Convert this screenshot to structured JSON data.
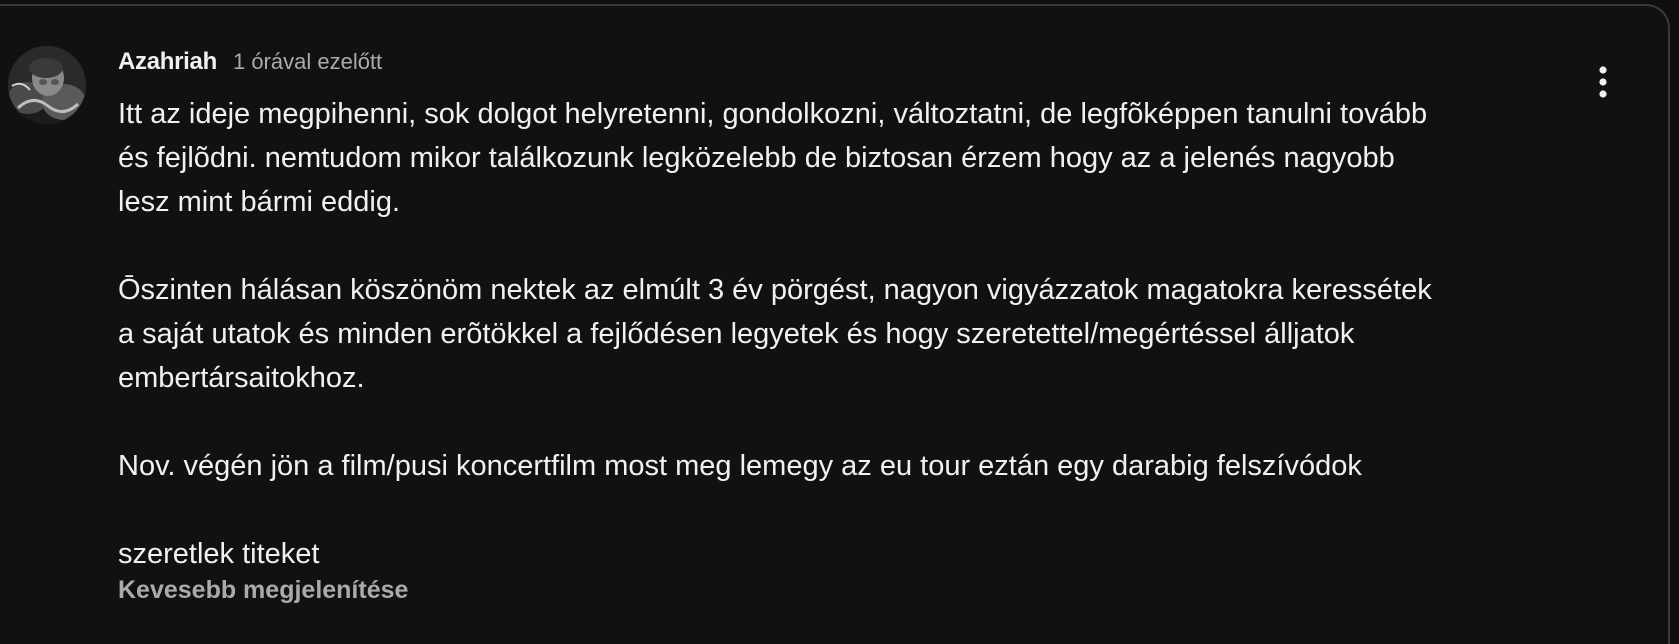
{
  "comment": {
    "author": "Azahriah",
    "timestamp": "1 órával ezelőtt",
    "avatar_icon": "user-avatar-photo",
    "text_lines": [
      "Itt az ideje megpihenni, sok dolgot helyretenni, gondolkozni, változtatni, de legfõképpen tanulni tovább",
      "és fejlõdni. nemtudom mikor találkozunk legközelebb de biztosan érzem hogy az a jelenés nagyobb",
      "lesz mint bármi eddig.",
      "",
      "Ōszinten hálásan köszönöm nektek az elmúlt 3 év pörgést, nagyon vigyázzatok magatokra keressétek",
      "a saját utatok és minden erõtökkel a fejlődésen legyetek és hogy szeretettel/megértéssel álljatok",
      "embertársaitokhoz.",
      "",
      "Nov. végén jön a film/pusi koncertfilm most meg lemegy az eu tour eztán egy darabig felszívódok",
      "",
      "szeretlek titeket"
    ],
    "show_less_label": "Kevesebb megjelenítése",
    "menu_icon": "more-vert-icon"
  },
  "colors": {
    "background": "#111111",
    "text_primary": "#f1f1f1",
    "text_secondary": "#aaaaaa",
    "border": "#3a3a3a"
  }
}
